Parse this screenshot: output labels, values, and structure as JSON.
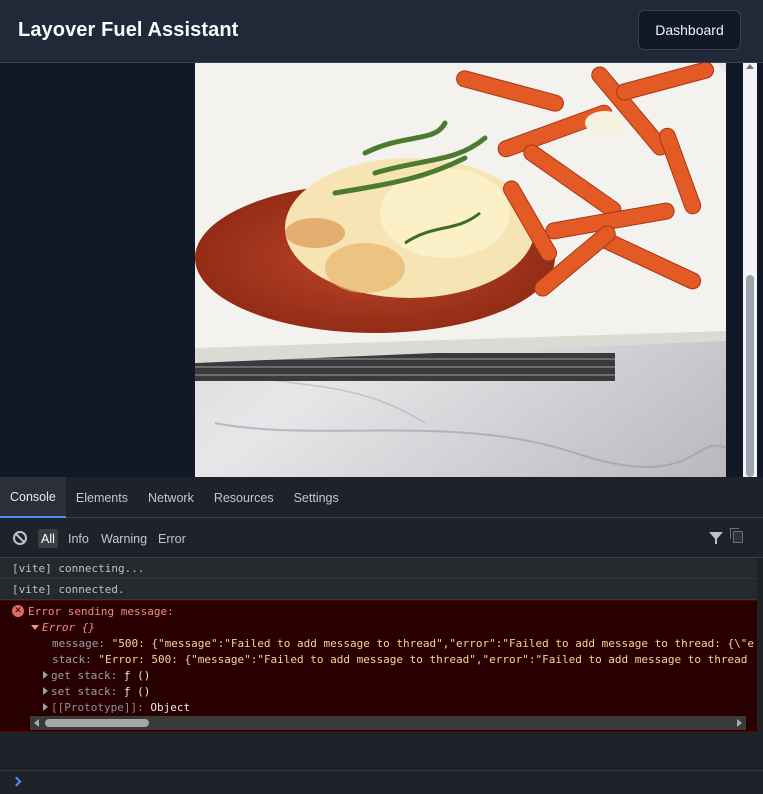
{
  "app": {
    "title": "Layover Fuel Assistant",
    "dashboard_label": "Dashboard"
  },
  "main": {
    "image_icon": "food-photo-chicken-parmesan-with-penne"
  },
  "devtools": {
    "tabs": [
      {
        "label": "Console"
      },
      {
        "label": "Elements"
      },
      {
        "label": "Network"
      },
      {
        "label": "Resources"
      },
      {
        "label": "Settings"
      }
    ],
    "levels": [
      {
        "label": "All"
      },
      {
        "label": "Info"
      },
      {
        "label": "Warning"
      },
      {
        "label": "Error"
      }
    ],
    "logs": [
      "[vite] connecting...",
      "[vite] connected."
    ],
    "error": {
      "title": "Error sending message:",
      "object": "Error {}",
      "message_key": "message:",
      "message_val": "\"500: {\"message\":\"Failed to add message to thread\",\"error\":\"Failed to add message to thread: {\\\"e",
      "stack_key": "stack:",
      "stack_val": "\"Error: 500: {\"message\":\"Failed to add message to thread\",\"error\":\"Failed to add message to thread",
      "get_stack": "get stack:",
      "set_stack": "set stack:",
      "fn_text": "ƒ ()",
      "proto_key": "[[Prototype]]:",
      "proto_val": "Object"
    },
    "colors": {
      "accent": "#4f8ff7",
      "error_bg": "#290000",
      "error_text": "#f28b82"
    }
  }
}
